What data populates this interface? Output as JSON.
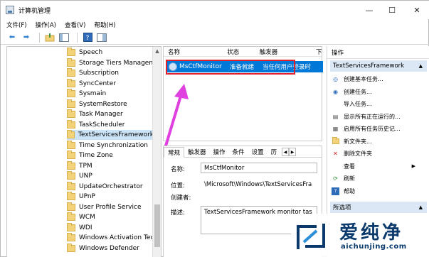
{
  "window": {
    "title": "计算机管理"
  },
  "menu": [
    "文件(F)",
    "操作(A)",
    "查看(V)",
    "帮助(H)"
  ],
  "tree": {
    "items": [
      {
        "label": "Speech"
      },
      {
        "label": "Storage Tiers Managen"
      },
      {
        "label": "Subscription"
      },
      {
        "label": "SyncCenter"
      },
      {
        "label": "Sysmain"
      },
      {
        "label": "SystemRestore"
      },
      {
        "label": "Task Manager"
      },
      {
        "label": "TaskScheduler"
      },
      {
        "label": "TextServicesFramework",
        "selected": true
      },
      {
        "label": "Time Synchronization"
      },
      {
        "label": "Time Zone"
      },
      {
        "label": "TPM"
      },
      {
        "label": "UNP"
      },
      {
        "label": "UpdateOrchestrator"
      },
      {
        "label": "UPnP"
      },
      {
        "label": "User Profile Service"
      },
      {
        "label": "WCM"
      },
      {
        "label": "WDI"
      },
      {
        "label": "Windows Activation Tec"
      },
      {
        "label": "Windows Defender"
      }
    ]
  },
  "list": {
    "columns": [
      "名称",
      "状态",
      "触发器",
      "下"
    ],
    "rows": [
      {
        "name": "MsCtfMonitor",
        "status": "准备就绪",
        "trigger": "当任何用户登录时"
      }
    ]
  },
  "props": {
    "tabs": [
      "常规",
      "触发器",
      "操作",
      "条件",
      "设置",
      "历"
    ],
    "labels": {
      "name": "名称:",
      "location": "位置:",
      "author": "创建者:",
      "description": "描述:"
    },
    "values": {
      "name": "MsCtfMonitor",
      "location": "\\Microsoft\\Windows\\TextServicesFra",
      "author": "",
      "description": "TextServicesFramework monitor tas"
    }
  },
  "actions": {
    "header": "操作",
    "section1": "TextServicesFramework",
    "items": [
      {
        "label": "创建基本任务...",
        "icon": "basic-task-icon"
      },
      {
        "label": "创建任务...",
        "icon": "task-icon"
      },
      {
        "label": "导入任务...",
        "icon": "import-icon"
      },
      {
        "label": "显示所有正在运行的...",
        "icon": "running-icon"
      },
      {
        "label": "启用所有任务历史记...",
        "icon": "history-icon"
      },
      {
        "label": "新文件夹...",
        "icon": "new-folder-icon"
      },
      {
        "label": "删除文件夹",
        "icon": "delete-icon"
      },
      {
        "label": "查看",
        "icon": "view-icon"
      },
      {
        "label": "刷新",
        "icon": "refresh-icon"
      },
      {
        "label": "帮助",
        "icon": "help-icon"
      }
    ],
    "section2": "所选项"
  },
  "watermark": {
    "brand": "爱纯净",
    "url": "aichunjing.com"
  },
  "colors": {
    "selection": "#0078d7",
    "highlight_box": "#e3212b",
    "arrow": "#e040e0",
    "section_bg": "#dbe7f5"
  }
}
